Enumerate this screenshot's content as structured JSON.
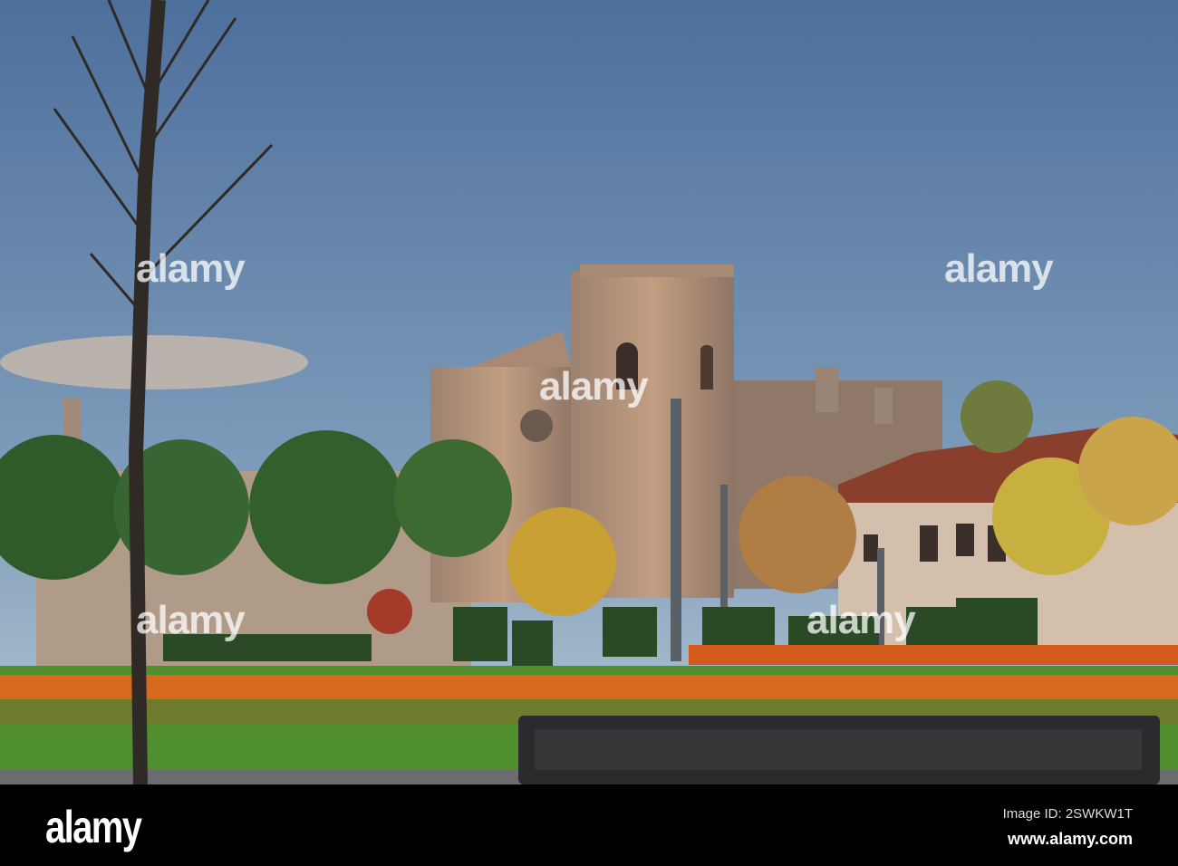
{
  "photo": {
    "subject": "Plaza with garden and historic stone building at dusk",
    "colors": {
      "sky_top": "#4d6f9c",
      "sky_bottom": "#a9bfd1",
      "stone": "#b89478",
      "grass": "#4f8f2e",
      "bench": "#2b2b2d"
    }
  },
  "watermark": {
    "text": "alamy"
  },
  "footer": {
    "logo": "alamy",
    "image_id": "Image ID: 2SWKW1T",
    "website": "www.alamy.com"
  }
}
